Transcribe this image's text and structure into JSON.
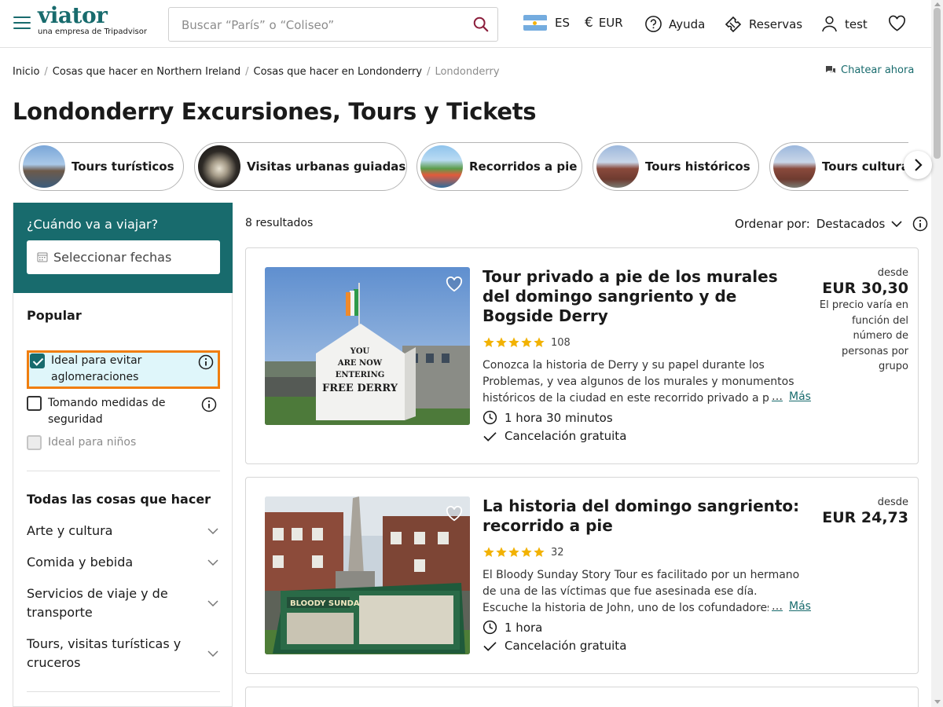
{
  "header": {
    "logo": "viator",
    "logo_sub": "una empresa de Tripadvisor",
    "search_placeholder": "Buscar “París” o “Coliseo”",
    "language": "ES",
    "currency": "EUR",
    "help": "Ayuda",
    "bookings": "Reservas",
    "user": "test"
  },
  "breadcrumb": {
    "items": [
      "Inicio",
      "Cosas que hacer en Northern Ireland",
      "Cosas que hacer en Londonderry"
    ],
    "current": "Londonderry"
  },
  "chat_label": "Chatear ahora",
  "page_title": "Londonderry Excursiones, Tours y Tickets",
  "categories": [
    {
      "label": "Tours turísticos"
    },
    {
      "label": "Visitas urbanas guiadas"
    },
    {
      "label": "Recorridos a pie"
    },
    {
      "label": "Tours históricos"
    },
    {
      "label": "Tours culturales"
    }
  ],
  "sidebar": {
    "date_question": "¿Cuándo va a viajar?",
    "date_placeholder": "Seleccionar fechas",
    "popular_heading": "Popular",
    "filters": [
      {
        "label": "Ideal para evitar aglomeraciones",
        "checked": true
      },
      {
        "label": "Tomando medidas de seguridad",
        "checked": false
      },
      {
        "label": "Ideal para niños",
        "disabled": true
      }
    ],
    "all_heading": "Todas las cosas que hacer",
    "all_categories": [
      "Arte y cultura",
      "Comida y bebida",
      "Servicios de viaje y de transporte",
      "Tours, visitas turísticas y cruceros"
    ]
  },
  "results": {
    "count": "8 resultados",
    "sort_label": "Ordenar por:",
    "sort_value": "Destacados",
    "more_label": "Más",
    "items": [
      {
        "title": "Tour privado a pie de los murales del domingo sangriento y de Bogside Derry",
        "rating": 5,
        "reviews": "108",
        "description": "Conozca la historia de Derry y su papel durante los Problemas, y vea algunos de los murales y monumentos históricos de la ciudad en este recorrido privado a pie.",
        "duration": "1 hora 30 minutos",
        "cancellation": "Cancelación gratuita",
        "price_from": "desde",
        "price": "EUR 30,30",
        "price_note": "El precio varía en función del número de personas por grupo"
      },
      {
        "title": "La historia del domingo sangriento: recorrido a pie",
        "rating": 5,
        "reviews": "32",
        "description": "El Bloody Sunday Story Tour es facilitado por un hermano de una de las víctimas que fue asesinada ese día. Escuche la historia de John, uno de los cofundadores del museo.",
        "duration": "1 hora",
        "cancellation": "Cancelación gratuita",
        "price_from": "desde",
        "price": "EUR 24,73"
      }
    ]
  },
  "colors": {
    "brand": "#186b6d",
    "highlight_border": "#f07e0f",
    "highlight_bg": "#dff6fa",
    "star": "#f2b203"
  }
}
